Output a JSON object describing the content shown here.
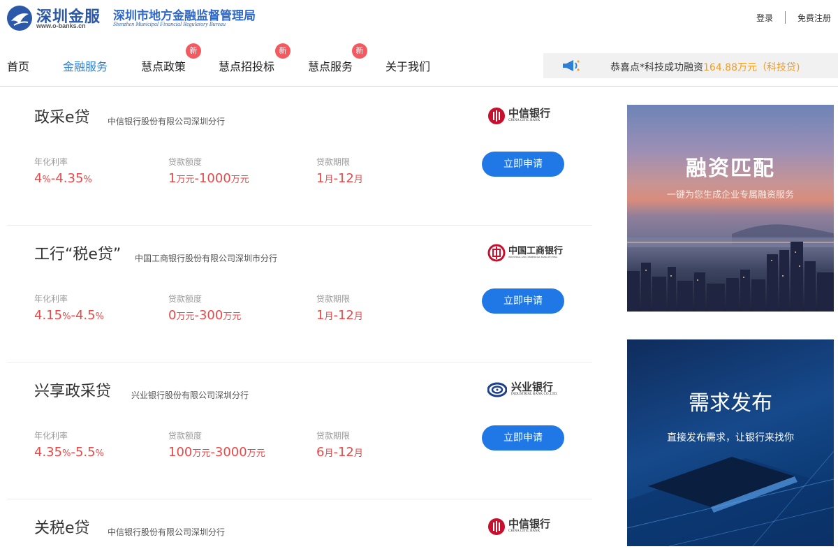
{
  "header": {
    "brand": "深圳金服",
    "brand_url": "www.o-banks.cn",
    "regulator_cn": "深圳市地方金融监督管理局",
    "regulator_en": "Shenzhen Municipal Financial Regulatory Bureau",
    "login": "登录",
    "register": "免费注册"
  },
  "nav": {
    "items": [
      {
        "label": "首页",
        "active": false,
        "badge": ""
      },
      {
        "label": "金融服务",
        "active": true,
        "badge": ""
      },
      {
        "label": "慧点政策",
        "active": false,
        "badge": "新"
      },
      {
        "label": "慧点招投标",
        "active": false,
        "badge": "新"
      },
      {
        "label": "慧点服务",
        "active": false,
        "badge": "新"
      },
      {
        "label": "关于我们",
        "active": false,
        "badge": ""
      }
    ]
  },
  "notice": {
    "prefix": "恭喜点*科技成功融资",
    "highlight": "164.88万元（科技贷)"
  },
  "labels": {
    "rate": "年化利率",
    "amount": "贷款额度",
    "term": "贷款期限",
    "apply": "立即申请"
  },
  "loans": [
    {
      "name": "政采e贷",
      "bank": "中信银行股份有限公司深圳分行",
      "bank_logo": {
        "cn": "中信银行",
        "en": "CHINA CITIC BANK",
        "icon": "citic-bank-icon"
      },
      "rate": {
        "low": "4",
        "lunit": "%",
        "sep": "-",
        "high": "4.35",
        "hunit": "%"
      },
      "amount": {
        "low": "1",
        "lunit": "万元",
        "sep": "-",
        "high": "1000",
        "hunit": "万元"
      },
      "term": {
        "low": "1",
        "lunit": "月",
        "sep": "-",
        "high": "12",
        "hunit": "月"
      }
    },
    {
      "name": "工行“税e贷”",
      "bank": "中国工商银行股份有限公司深圳市分行",
      "bank_logo": {
        "cn": "中国工商银行",
        "en": "INDUSTRIAL AND COMMERCIAL BANK OF CHINA",
        "icon": "icbc-icon"
      },
      "rate": {
        "low": "4.15",
        "lunit": "%",
        "sep": "-",
        "high": "4.5",
        "hunit": "%"
      },
      "amount": {
        "low": "0",
        "lunit": "万元",
        "sep": "-",
        "high": "300",
        "hunit": "万元"
      },
      "term": {
        "low": "1",
        "lunit": "月",
        "sep": "-",
        "high": "12",
        "hunit": "月"
      }
    },
    {
      "name": "兴享政采贷",
      "bank": "兴业银行股份有限公司深圳分行",
      "bank_logo": {
        "cn": "兴业银行",
        "en": "INDUSTRIAL BANK CO.,LTD.",
        "icon": "cib-icon"
      },
      "rate": {
        "low": "4.35",
        "lunit": "%",
        "sep": "-",
        "high": "5.5",
        "hunit": "%"
      },
      "amount": {
        "low": "100",
        "lunit": "万元",
        "sep": "-",
        "high": "3000",
        "hunit": "万元"
      },
      "term": {
        "low": "6",
        "lunit": "月",
        "sep": "-",
        "high": "12",
        "hunit": "月"
      }
    },
    {
      "name": "关税e贷",
      "bank": "中信银行股份有限公司深圳分行",
      "bank_logo": {
        "cn": "中信银行",
        "en": "CHINA CITIC BANK",
        "icon": "citic-bank-icon"
      }
    }
  ],
  "banners": [
    {
      "title": "融资匹配",
      "subtitle": "一键为您生成企业专属融资服务"
    },
    {
      "title": "需求发布",
      "subtitle": "直接发布需求，让银行来找你"
    }
  ],
  "colors": {
    "accent": "#1f78e6",
    "nav_active": "#2f7fd6",
    "value_red": "#e84848",
    "badge": "#f3595e",
    "notice_highlight": "#f39c1e"
  }
}
